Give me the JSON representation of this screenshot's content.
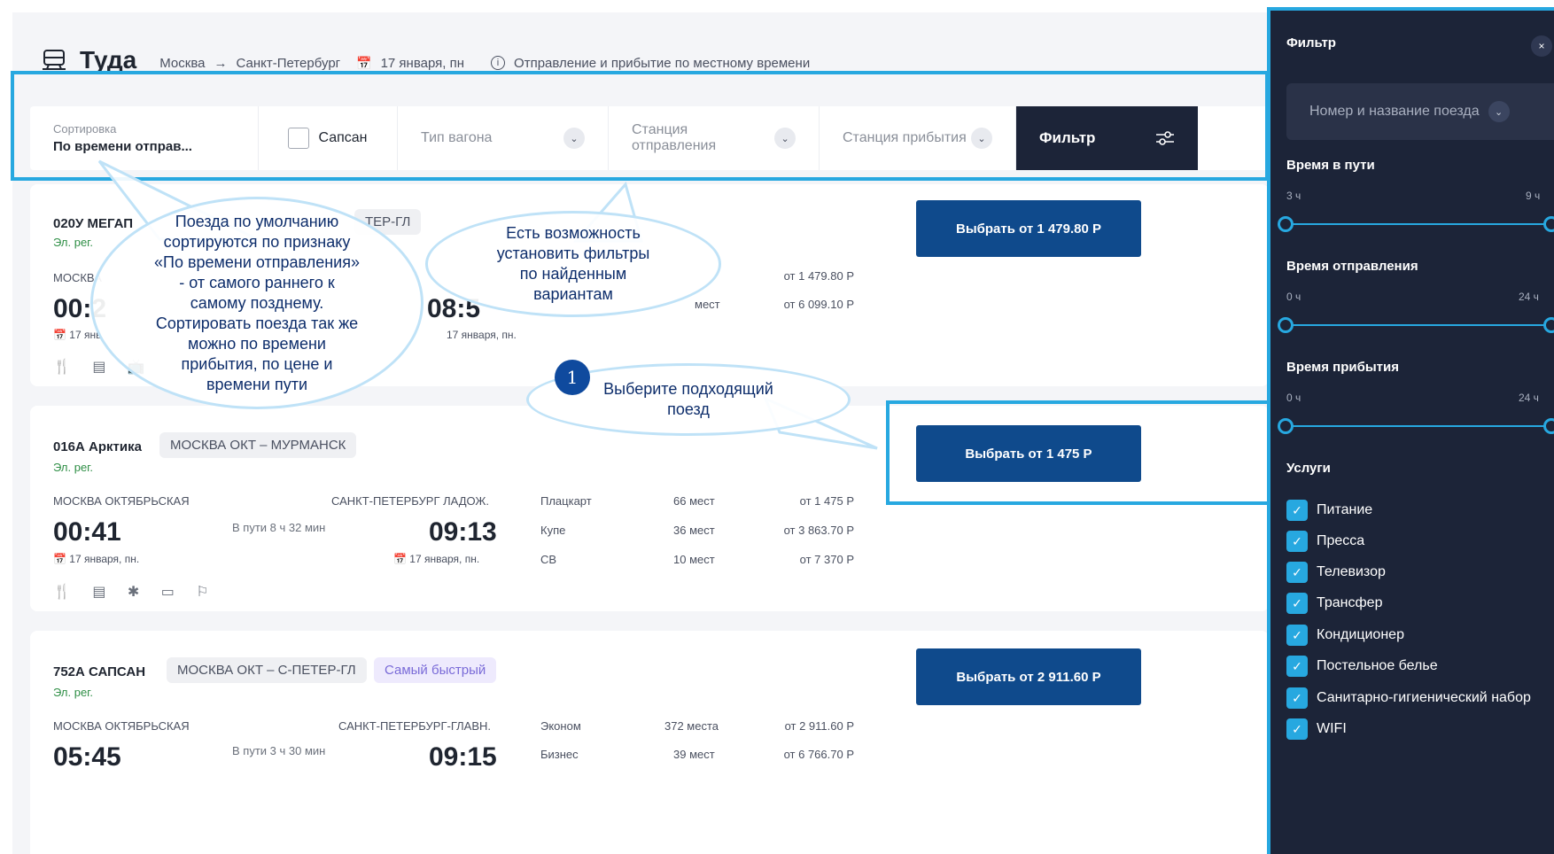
{
  "header": {
    "title": "Туда",
    "from": "Москва",
    "arrow": "→",
    "to": "Санкт-Петербург",
    "date": "17 января, пн",
    "note": "Отправление и прибытие по местному времени"
  },
  "filterbar": {
    "sort_label": "Сортировка",
    "sort_value": "По времени отправ...",
    "sapsan_label": "Сапсан",
    "car_type": "Тип вагона",
    "dep_station": "Станция отправления",
    "arr_station": "Станция прибытия",
    "filter_button": "Фильтр"
  },
  "trains": [
    {
      "name": "020У МЕГАП",
      "route": "ТЕР-ГЛ",
      "sub": "Эл. рег.",
      "from_station": "МОСКВА",
      "dep_time": "00:2",
      "arr_time": "08:5",
      "dep_date": "17 янв",
      "arr_date": "17 января, пн.",
      "classes": [
        {
          "name": "",
          "seats": "мест",
          "price": "от 1 479.80 Р"
        },
        {
          "name": "",
          "seats": "",
          "price": "от 6 099.10 Р"
        }
      ],
      "button": "Выбрать от 1 479.80 Р",
      "amenities": "🍴 ▤ 📺"
    },
    {
      "name": "016А Арктика",
      "route": "МОСКВА ОКТ – МУРМАНСК",
      "sub": "Эл. рег.",
      "from_station": "МОСКВА ОКТЯБРЬСКАЯ",
      "to_station": "САНКТ-ПЕТЕРБУРГ ЛАДОЖ.",
      "dep_time": "00:41",
      "arr_time": "09:13",
      "duration": "В пути 8 ч 32 мин",
      "dep_date": "17 января, пн.",
      "arr_date": "17 января, пн.",
      "classes": [
        {
          "name": "Плацкарт",
          "seats": "66 мест",
          "price": "от 1 475 Р"
        },
        {
          "name": "Купе",
          "seats": "36 мест",
          "price": "от 3 863.70 Р"
        },
        {
          "name": "СВ",
          "seats": "10 мест",
          "price": "от 7 370 Р"
        }
      ],
      "button": "Выбрать от 1 475 Р",
      "amenities": "🍴 ▤ ✱ ▭ ⚐"
    },
    {
      "name": "752А САПСАН",
      "route": "МОСКВА ОКТ – С-ПЕТЕР-ГЛ",
      "badge": "Самый быстрый",
      "sub": "Эл. рег.",
      "from_station": "МОСКВА ОКТЯБРЬСКАЯ",
      "to_station": "САНКТ-ПЕТЕРБУРГ-ГЛАВН.",
      "dep_time": "05:45",
      "arr_time": "09:15",
      "duration": "В пути 3 ч 30 мин",
      "classes": [
        {
          "name": "Эконом",
          "seats": "372 места",
          "price": "от 2 911.60 Р"
        },
        {
          "name": "Бизнес",
          "seats": "39 мест",
          "price": "от 6 766.70 Р"
        }
      ],
      "button": "Выбрать от 2 911.60 Р"
    }
  ],
  "callouts": {
    "sort": "Поезда по умолчанию сортируются по признаку «По времени отправления» - от самого раннего к самому позднему. Сортировать поезда так же можно по времени прибытия, по цене и времени пути",
    "filters": "Есть возможность установить фильтры по найденным вариантам",
    "step_number": "1",
    "choose": "Выберите подходящий поезд"
  },
  "panel": {
    "title": "Фильтр",
    "close": "×",
    "train_select": "Номер и название поезда",
    "travel_time": {
      "label": "Время в пути",
      "min": "3 ч",
      "max": "9 ч"
    },
    "departure_time": {
      "label": "Время отправления",
      "min": "0 ч",
      "max": "24 ч"
    },
    "arrival_time": {
      "label": "Время прибытия",
      "min": "0 ч",
      "max": "24 ч"
    },
    "services_label": "Услуги",
    "services": [
      "Питание",
      "Пресса",
      "Телевизор",
      "Трансфер",
      "Кондиционер",
      "Постельное белье",
      "Санитарно-гигиенический набор",
      "WIFI"
    ]
  },
  "colors": {
    "accent": "#27a8e0",
    "primary_button": "#0f4a8c",
    "panel_bg": "#1c2438",
    "callout_text": "#0d2d6b"
  }
}
